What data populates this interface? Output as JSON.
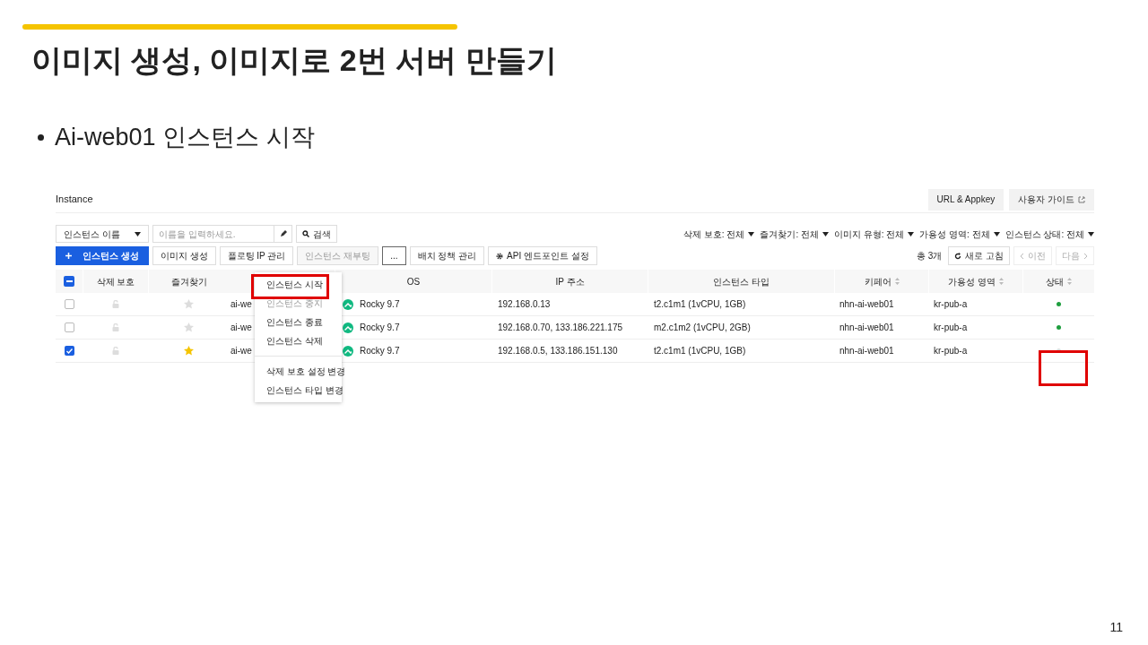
{
  "slide": {
    "title": "이미지 생성, 이미지로 2번 서버 만들기",
    "bullet": "Ai-web01 인스턴스 시작",
    "page_number": "11"
  },
  "console": {
    "title": "Instance",
    "header_buttons": [
      {
        "label": "URL & Appkey",
        "external": false
      },
      {
        "label": "사용자 가이드",
        "external": true
      }
    ],
    "search": {
      "field_select": "인스턴스 이름",
      "placeholder": "이름을 입력하세요.",
      "button": "검색"
    },
    "filters": [
      "삭제 보호: 전체",
      "즐겨찾기: 전체",
      "이미지 유형: 전체",
      "가용성 영역: 전체",
      "인스턴스 상태: 전체"
    ],
    "actions": [
      {
        "label": "인스턴스 생성",
        "kind": "primary",
        "disabled": false
      },
      {
        "label": "이미지 생성",
        "kind": "default",
        "disabled": false
      },
      {
        "label": "플로팅 IP 관리",
        "kind": "default",
        "disabled": false
      },
      {
        "label": "인스턴스 재부팅",
        "kind": "default",
        "disabled": true
      },
      {
        "label": "...",
        "kind": "more",
        "disabled": false
      },
      {
        "label": "배치 정책 관리",
        "kind": "default",
        "disabled": false
      },
      {
        "label": "API 엔드포인트 설정",
        "kind": "gear",
        "disabled": false
      }
    ],
    "total": "총 3개",
    "refresh": "새로 고침",
    "prev": "이전",
    "next": "다음",
    "select_all_indeterminate": true,
    "columns": [
      {
        "label": "삭제 보호",
        "sortable": false
      },
      {
        "label": "즐겨찾기",
        "sortable": false
      },
      {
        "label": "OS",
        "sortable": false
      },
      {
        "label": "IP 주소",
        "sortable": false
      },
      {
        "label": "인스턴스 타입",
        "sortable": false
      },
      {
        "label": "키페어",
        "sortable": true
      },
      {
        "label": "가용성 영역",
        "sortable": true
      },
      {
        "label": "상태",
        "sortable": true
      }
    ],
    "rows": [
      {
        "checked": false,
        "favorite": false,
        "name": "ai-we",
        "os": "Rocky 9.7",
        "ip": "192.168.0.13",
        "type": "t2.c1m1 (1vCPU, 1GB)",
        "keypair": "nhn-ai-web01",
        "zone": "kr-pub-a",
        "color": "#1e9e3e",
        "status_highlighted": false
      },
      {
        "checked": false,
        "favorite": false,
        "name": "ai-we",
        "os": "Rocky 9.7",
        "ip": "192.168.0.70, 133.186.221.175",
        "type": "m2.c1m2 (1vCPU, 2GB)",
        "keypair": "nhn-ai-web01",
        "zone": "kr-pub-a",
        "color": "#1e9e3e",
        "status_highlighted": false
      },
      {
        "checked": true,
        "favorite": true,
        "name": "ai-we",
        "os": "Rocky 9.7",
        "ip": "192.168.0.5, 133.186.151.130",
        "type": "t2.c1m1 (1vCPU, 1GB)",
        "keypair": "nhn-ai-web01",
        "zone": "kr-pub-a",
        "color": "#dddddd",
        "status_highlighted": true
      }
    ],
    "menu": [
      {
        "label": "인스턴스 시작",
        "disabled": false,
        "highlighted": true,
        "divider_before": false
      },
      {
        "label": "인스턴스 중지",
        "disabled": true,
        "highlighted": false,
        "divider_before": false
      },
      {
        "label": "인스턴스 종료",
        "disabled": false,
        "highlighted": false,
        "divider_before": false
      },
      {
        "label": "인스턴스 삭제",
        "disabled": false,
        "highlighted": false,
        "divider_before": false
      },
      {
        "label": "삭제 보호 설정 변경",
        "disabled": false,
        "highlighted": false,
        "divider_before": true
      },
      {
        "label": "인스턴스 타입 변경",
        "disabled": false,
        "highlighted": false,
        "divider_before": false
      }
    ]
  }
}
